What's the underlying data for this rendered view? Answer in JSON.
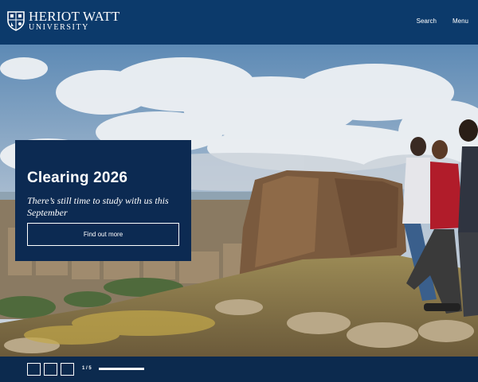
{
  "header": {
    "logo_line1": "HERIOT WATT",
    "logo_line2": "UNIVERSITY",
    "nav": [
      "Search",
      "Menu"
    ]
  },
  "hero": {
    "title": "Clearing 2026",
    "subtitle": "There’s still time to study with us this September",
    "button": "Find out more"
  },
  "carousel": {
    "counter": "1 / 5",
    "progress": 1.0
  },
  "colors": {
    "header_bg": "#0c3a6b",
    "card_bg": "#0c2a52",
    "footer_bg": "#0c2a4e"
  },
  "icons": [
    "crest-icon"
  ]
}
